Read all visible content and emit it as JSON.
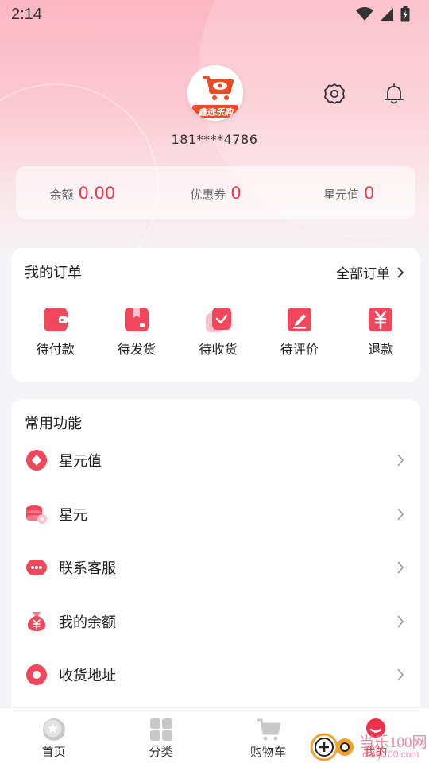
{
  "status_bar": {
    "time": "2:14"
  },
  "profile": {
    "phone": "181****4786",
    "logo_text": "鑫选乐购"
  },
  "wallet": [
    {
      "label": "余额",
      "value": "0.00"
    },
    {
      "label": "优惠券",
      "value": "0"
    },
    {
      "label": "星元值",
      "value": "0"
    }
  ],
  "orders": {
    "title": "我的订单",
    "all_label": "全部订单",
    "items": [
      {
        "label": "待付款",
        "icon": "wallet-icon"
      },
      {
        "label": "待发货",
        "icon": "package-icon"
      },
      {
        "label": "待收货",
        "icon": "receive-icon"
      },
      {
        "label": "待评价",
        "icon": "review-icon"
      },
      {
        "label": "退款",
        "icon": "refund-icon"
      }
    ]
  },
  "functions": {
    "title": "常用功能",
    "items": [
      {
        "label": "星元值",
        "icon": "diamond-icon"
      },
      {
        "label": "星元",
        "icon": "coins-icon"
      },
      {
        "label": "联系客服",
        "icon": "chat-icon"
      },
      {
        "label": "我的余额",
        "icon": "money-bag-icon"
      },
      {
        "label": "收货地址",
        "icon": "location-icon"
      }
    ]
  },
  "tabbar": [
    {
      "label": "首页",
      "icon": "home-icon"
    },
    {
      "label": "分类",
      "icon": "category-icon"
    },
    {
      "label": "购物车",
      "icon": "cart-icon"
    },
    {
      "label": "我的",
      "icon": "profile-icon"
    }
  ],
  "watermark": {
    "text": "当乐100网",
    "sub": "danji100.com"
  },
  "colors": {
    "accent": "#f2364e",
    "hero_pink": "#fbb6c4"
  }
}
